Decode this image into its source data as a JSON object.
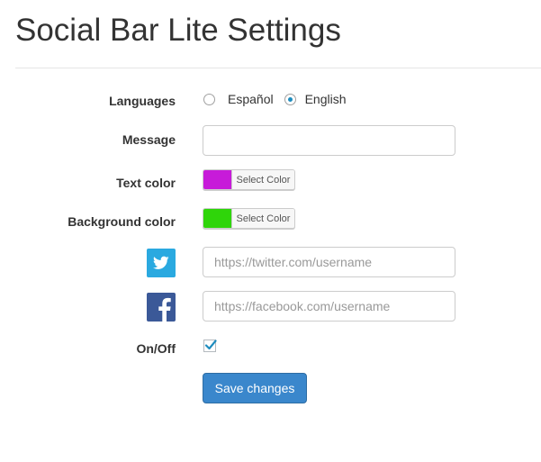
{
  "page": {
    "title": "Social Bar Lite Settings"
  },
  "languages": {
    "label": "Languages",
    "options": [
      {
        "label": "Español",
        "checked": false
      },
      {
        "label": "English",
        "checked": true
      }
    ]
  },
  "message": {
    "label": "Message",
    "value": "",
    "placeholder": ""
  },
  "text_color": {
    "label": "Text color",
    "button_label": "Select Color",
    "color": "#c71bd9"
  },
  "background_color": {
    "label": "Background color",
    "button_label": "Select Color",
    "color": "#2fd50a"
  },
  "twitter": {
    "icon": "twitter-icon",
    "placeholder": "https://twitter.com/username",
    "value": "",
    "brand_color": "#2aa9e0"
  },
  "facebook": {
    "icon": "facebook-icon",
    "placeholder": "https://facebook.com/username",
    "value": "",
    "brand_color": "#3b5998"
  },
  "on_off": {
    "label": "On/Off",
    "checked": true
  },
  "actions": {
    "save_label": "Save changes"
  }
}
